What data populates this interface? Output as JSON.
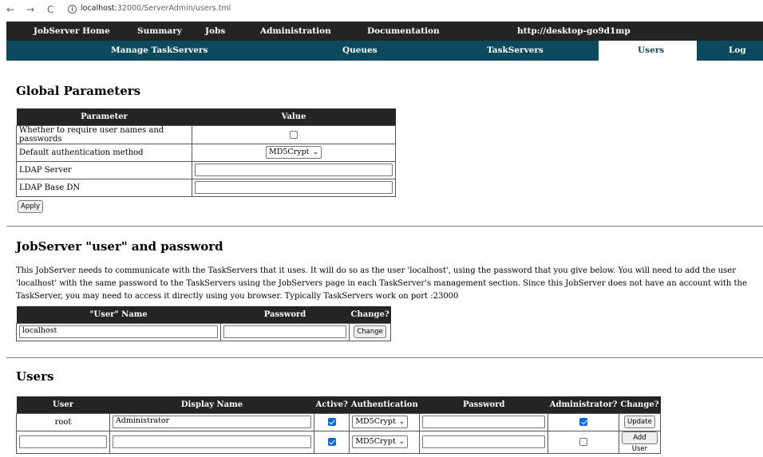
{
  "browser": {
    "back": "←",
    "forward": "→",
    "reload": "C",
    "url_host": "localhost",
    "url_path": ":32000/ServerAdmin/users.tml"
  },
  "topnav": {
    "items": [
      "JobServer Home",
      "Summary",
      "Jobs",
      "Administration",
      "Documentation",
      "http://desktop-go9d1mp"
    ]
  },
  "subnav": {
    "items": [
      "Manage TaskServers",
      "Queues",
      "TaskServers",
      "Users",
      "Log"
    ],
    "active": "Users"
  },
  "global": {
    "heading": "Global Parameters",
    "col_parameter": "Parameter",
    "col_value": "Value",
    "rows": [
      {
        "label": "Whether to require user names and passwords",
        "checked": false
      },
      {
        "label": "Default authentication method",
        "select": "MD5Crypt"
      },
      {
        "label": "LDAP Server",
        "value": ""
      },
      {
        "label": "LDAP Base DN",
        "value": ""
      }
    ],
    "apply": "Apply"
  },
  "jobserver": {
    "heading": "JobServer \"user\" and password",
    "paragraph": "This JobServer needs to communicate with the TaskServers that it uses. It will do so as the user 'localhost', using the password that you give below. You will need to add the user 'localhost' with the same password to the TaskServers using the JobServers page in each TaskServer's management section. Since this JobServer does not have an account with the TaskServer, you may need to access it directly using you browser. Typically TaskServers work on port :23000",
    "col_user": "\"User\" Name",
    "col_password": "Password",
    "col_change": "Change?",
    "user_value": "localhost",
    "password_value": "",
    "change": "Change"
  },
  "users": {
    "heading": "Users",
    "columns": [
      "User",
      "Display Name",
      "Active?",
      "Authentication",
      "Password",
      "Administrator?",
      "Change?"
    ],
    "rows": [
      {
        "user": "root",
        "display": "Administrator",
        "active": true,
        "auth": "MD5Crypt",
        "password": "",
        "admin": true,
        "action": "Update"
      },
      {
        "user": "",
        "display": "",
        "active": true,
        "auth": "MD5Crypt",
        "password": "",
        "admin": false,
        "action": "Add User"
      }
    ]
  },
  "colors": {
    "nav_dark": "#242424",
    "nav_teal": "#0b4a5c",
    "check_blue": "#0b68d1"
  },
  "icons": {
    "chevron": "⌄",
    "info": "i"
  }
}
